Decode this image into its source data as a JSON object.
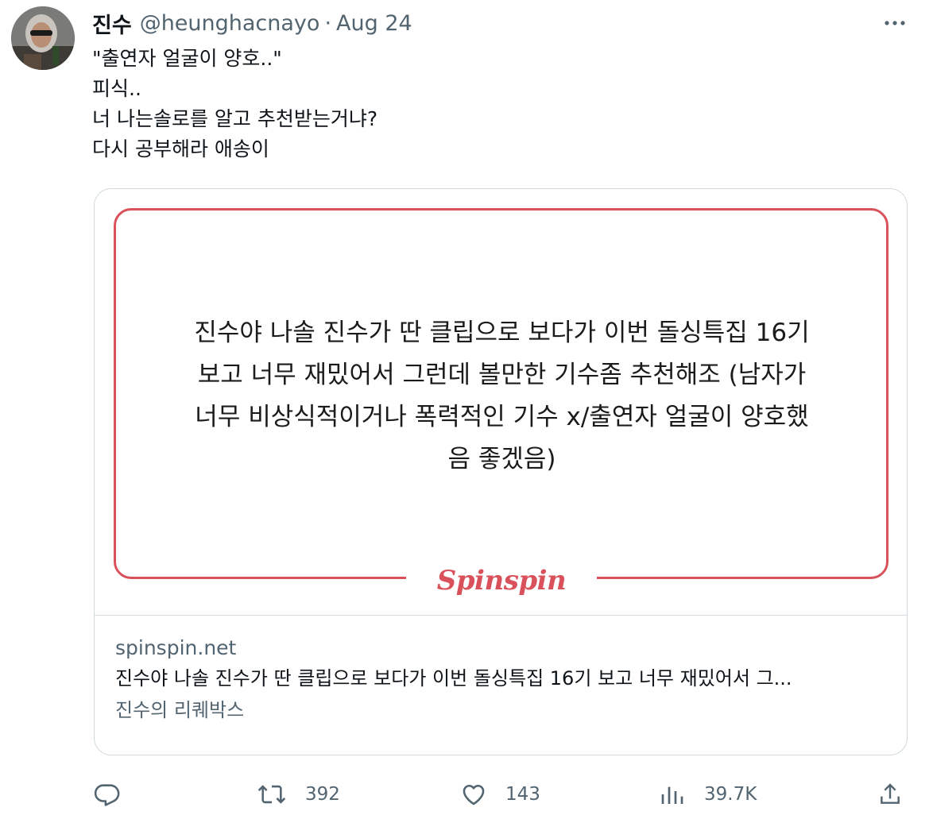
{
  "tweet": {
    "display_name": "진수",
    "handle": "@heunghacnayo",
    "separator": "·",
    "timestamp": "Aug 24",
    "text_lines": [
      "\"출연자 얼굴이 양호..\"",
      "피식..",
      "너 나는솔로를 알고 추천받는거냐?",
      "다시 공부해라 애송이"
    ]
  },
  "card": {
    "image_quote_lines": [
      "진수야 나솔 진수가 딴 클립으로 보다가 이번 돌싱특집 16기",
      "보고 너무 재밌어서 그런데 볼만한 기수좀 추천해조 (남자가",
      "너무 비상식적이거나 폭력적인 기수 x/출연자 얼굴이 양호했",
      "음 좋겠음)"
    ],
    "brand_logo": "Spinspin",
    "domain": "spinspin.net",
    "title": "진수야 나솔 진수가 딴 클립으로 보다가 이번 돌싱특집 16기 보고 너무 재밌어서 그...",
    "description": "진수의 리퀘박스",
    "accent_color": "#d9515a"
  },
  "actions": {
    "reply": {
      "icon": "reply-icon",
      "count": ""
    },
    "retweet": {
      "icon": "retweet-icon",
      "count": "392"
    },
    "like": {
      "icon": "heart-icon",
      "count": "143"
    },
    "views": {
      "icon": "views-icon",
      "count": "39.7K"
    },
    "share": {
      "icon": "share-icon",
      "count": ""
    }
  }
}
